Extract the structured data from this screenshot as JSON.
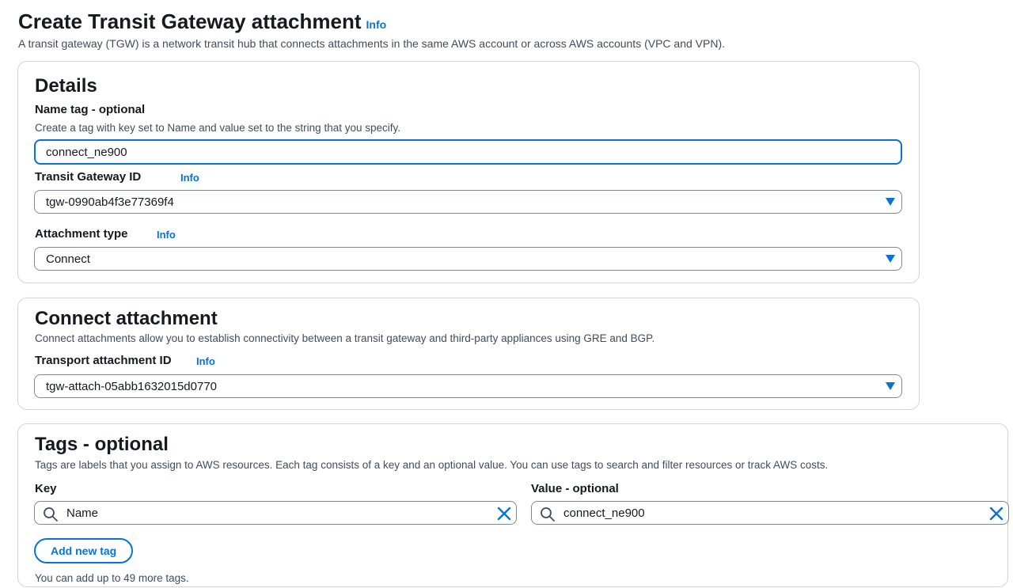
{
  "header": {
    "title": "Create Transit Gateway attachment",
    "info": "Info",
    "description": "A transit gateway (TGW) is a network transit hub that connects attachments in the same AWS account or across AWS accounts (VPC and VPN)."
  },
  "details": {
    "title": "Details",
    "name_tag": {
      "label": "Name tag - optional",
      "description": "Create a tag with key set to Name and value set to the string that you specify.",
      "value": "connect_ne900"
    },
    "tgw_id": {
      "label": "Transit Gateway ID",
      "info": "Info",
      "value": "tgw-0990ab4f3e77369f4"
    },
    "attachment_type": {
      "label": "Attachment type",
      "info": "Info",
      "value": "Connect"
    }
  },
  "connect": {
    "title": "Connect attachment",
    "description": "Connect attachments allow you to establish connectivity between a transit gateway and third-party appliances using GRE and BGP.",
    "transport": {
      "label": "Transport attachment ID",
      "info": "Info",
      "value": "tgw-attach-05abb1632015d0770"
    }
  },
  "tags": {
    "title": "Tags - optional",
    "description": "Tags are labels that you assign to AWS resources. Each tag consists of a key and an optional value. You can use tags to search and filter resources or track AWS costs.",
    "key_label": "Key",
    "value_label": "Value - optional",
    "rows": [
      {
        "key": "Name",
        "value": "connect_ne900"
      }
    ],
    "add_button": "Add new tag",
    "limit_note": "You can add up to 49 more tags."
  },
  "colors": {
    "accent": "#0972d3",
    "text": "#16191f",
    "muted": "#414d5c",
    "border": "#7d8998"
  },
  "icons": [
    "search-icon",
    "close-icon",
    "caret-down-icon"
  ]
}
